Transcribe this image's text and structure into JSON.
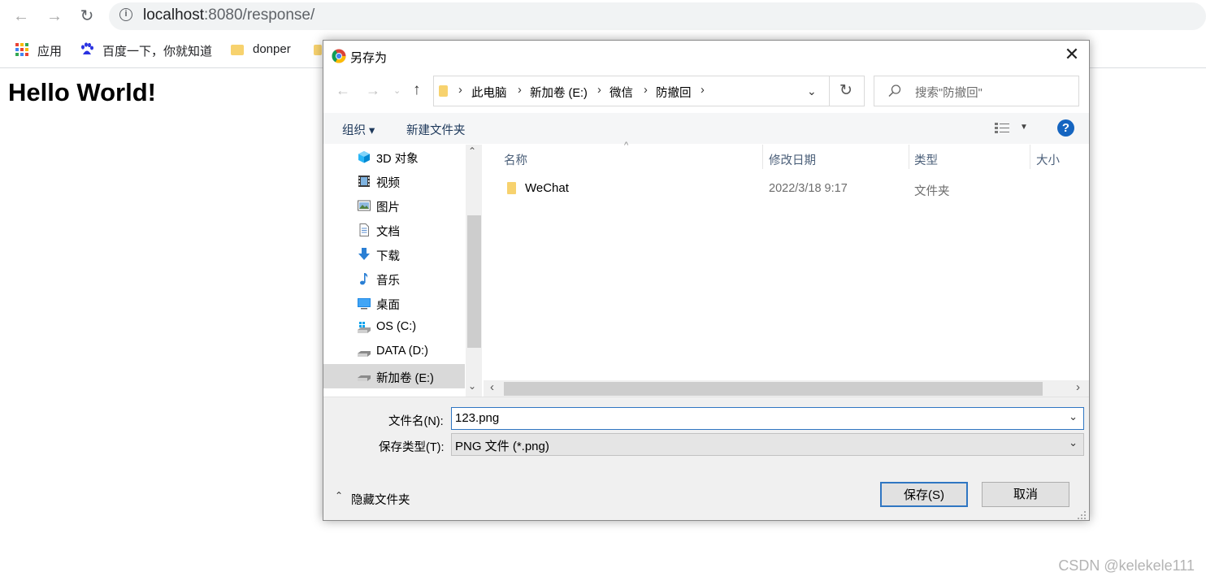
{
  "browser": {
    "url_host": "localhost",
    "url_path": ":8080/response/",
    "bookmarks": [
      "应用",
      "百度一下，你就知道",
      "donper"
    ]
  },
  "page": {
    "heading": "Hello World!"
  },
  "dialog": {
    "title": "另存为",
    "breadcrumb": [
      "此电脑",
      "新加卷 (E:)",
      "微信",
      "防撤回"
    ],
    "search_placeholder": "搜索\"防撤回\"",
    "organize_label": "组织 ▾",
    "new_folder_label": "新建文件夹",
    "nav_items": [
      {
        "label": "3D 对象",
        "icon": "3d-objects-icon"
      },
      {
        "label": "视频",
        "icon": "video-icon"
      },
      {
        "label": "图片",
        "icon": "pictures-icon"
      },
      {
        "label": "文档",
        "icon": "documents-icon"
      },
      {
        "label": "下载",
        "icon": "downloads-icon"
      },
      {
        "label": "音乐",
        "icon": "music-icon"
      },
      {
        "label": "桌面",
        "icon": "desktop-icon"
      },
      {
        "label": "OS (C:)",
        "icon": "drive-c-icon"
      },
      {
        "label": "DATA (D:)",
        "icon": "drive-icon"
      },
      {
        "label": "新加卷 (E:)",
        "icon": "drive-icon"
      }
    ],
    "columns": {
      "name": "名称",
      "modified": "修改日期",
      "type": "类型",
      "size": "大小"
    },
    "files": [
      {
        "name": "WeChat",
        "modified": "2022/3/18 9:17",
        "type": "文件夹"
      }
    ],
    "filename_label": "文件名(N):",
    "filename_value": "123.png",
    "filetype_label": "保存类型(T):",
    "filetype_value": "PNG 文件 (*.png)",
    "hide_folders_label": "隐藏文件夹",
    "save_label": "保存(S)",
    "cancel_label": "取消"
  },
  "watermark": "CSDN @kelekele111"
}
